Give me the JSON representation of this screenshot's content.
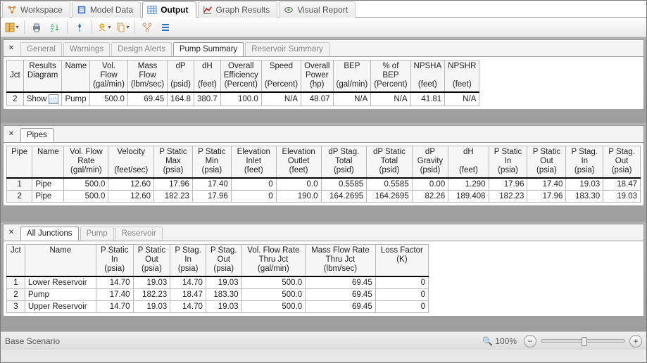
{
  "main_tabs": [
    {
      "label": "Workspace",
      "active": false
    },
    {
      "label": "Model Data",
      "active": false
    },
    {
      "label": "Output",
      "active": true
    },
    {
      "label": "Graph Results",
      "active": false
    },
    {
      "label": "Visual Report",
      "active": false
    }
  ],
  "toolbar_icons": [
    "layout-icon",
    "print-icon",
    "sort-icon",
    "pin-icon",
    "filter-icon",
    "copy-icon",
    "flow-icon",
    "list-icon"
  ],
  "panel_pump": {
    "sub_tabs": [
      "General",
      "Warnings",
      "Design Alerts",
      "Pump Summary",
      "Reservoir Summary"
    ],
    "active_index": 3,
    "headers": [
      [
        "Jct",
        "",
        "",
        ""
      ],
      [
        "Results",
        "Diagram",
        "",
        ""
      ],
      [
        "Name",
        "",
        "",
        ""
      ],
      [
        "Vol.",
        "Flow",
        "(gal/min)",
        ""
      ],
      [
        "Mass",
        "Flow",
        "(lbm/sec)",
        ""
      ],
      [
        "dP",
        "",
        "(psid)",
        ""
      ],
      [
        "dH",
        "",
        "(feet)",
        ""
      ],
      [
        "Overall",
        "Efficiency",
        "(Percent)",
        ""
      ],
      [
        "Speed",
        "",
        "(Percent)",
        ""
      ],
      [
        "Overall",
        "Power",
        "(hp)",
        ""
      ],
      [
        "BEP",
        "",
        "(gal/min)",
        ""
      ],
      [
        "% of",
        "BEP",
        "(Percent)",
        ""
      ],
      [
        "NPSHA",
        "",
        "(feet)",
        ""
      ],
      [
        "NPSHR",
        "",
        "(feet)",
        ""
      ]
    ],
    "row": {
      "jct": "2",
      "show": "Show",
      "name": "Pump",
      "volflow": "500.0",
      "massflow": "69.45",
      "dp": "164.8",
      "dh": "380.7",
      "effic": "100.0",
      "speed": "N/A",
      "power": "48.07",
      "bep": "N/A",
      "pctbep": "N/A",
      "npsha": "41.81",
      "npshr": "N/A"
    }
  },
  "panel_pipes": {
    "sub_tabs": [
      "Pipes"
    ],
    "active_index": 0,
    "headers": [
      "Pipe",
      "Name",
      "Vol. Flow\nRate\n(gal/min)",
      "Velocity\n\n(feet/sec)",
      "P Static\nMax\n(psia)",
      "P Static\nMin\n(psia)",
      "Elevation\nInlet\n(feet)",
      "Elevation\nOutlet\n(feet)",
      "dP Stag.\nTotal\n(psid)",
      "dP Static\nTotal\n(psid)",
      "dP\nGravity\n(psid)",
      "dH\n\n(feet)",
      "P Static\nIn\n(psia)",
      "P Static\nOut\n(psia)",
      "P Stag.\nIn\n(psia)",
      "P Stag.\nOut\n(psia)"
    ],
    "rows": [
      {
        "idx": "1",
        "name": "Pipe",
        "vals": [
          "500.0",
          "12.60",
          "17.96",
          "17.40",
          "0",
          "0.0",
          "0.5585",
          "0.5585",
          "0.00",
          "1.290",
          "17.96",
          "17.40",
          "19.03",
          "18.47"
        ]
      },
      {
        "idx": "2",
        "name": "Pipe",
        "vals": [
          "500.0",
          "12.60",
          "182.23",
          "17.96",
          "0",
          "190.0",
          "164.2695",
          "164.2695",
          "82.26",
          "189.408",
          "182.23",
          "17.96",
          "183.30",
          "19.03"
        ]
      }
    ]
  },
  "panel_jct": {
    "sub_tabs": [
      "All Junctions",
      "Pump",
      "Reservoir"
    ],
    "active_index": 0,
    "headers": [
      "Jct",
      "Name",
      "P Static\nIn\n(psia)",
      "P Static\nOut\n(psia)",
      "P Stag.\nIn\n(psia)",
      "P Stag.\nOut\n(psia)",
      "Vol. Flow Rate\nThru Jct\n(gal/min)",
      "Mass Flow Rate\nThru Jct\n(lbm/sec)",
      "Loss Factor\n(K)"
    ],
    "rows": [
      {
        "idx": "1",
        "name": "Lower Reservoir",
        "vals": [
          "14.70",
          "19.03",
          "14.70",
          "19.03",
          "500.0",
          "69.45",
          "0"
        ]
      },
      {
        "idx": "2",
        "name": "Pump",
        "vals": [
          "17.40",
          "182.23",
          "18.47",
          "183.30",
          "500.0",
          "69.45",
          "0"
        ]
      },
      {
        "idx": "3",
        "name": "Upper Reservoir",
        "vals": [
          "14.70",
          "19.03",
          "14.70",
          "19.03",
          "500.0",
          "69.45",
          "0"
        ]
      }
    ]
  },
  "status": {
    "scenario": "Base Scenario",
    "zoom": "100%"
  }
}
